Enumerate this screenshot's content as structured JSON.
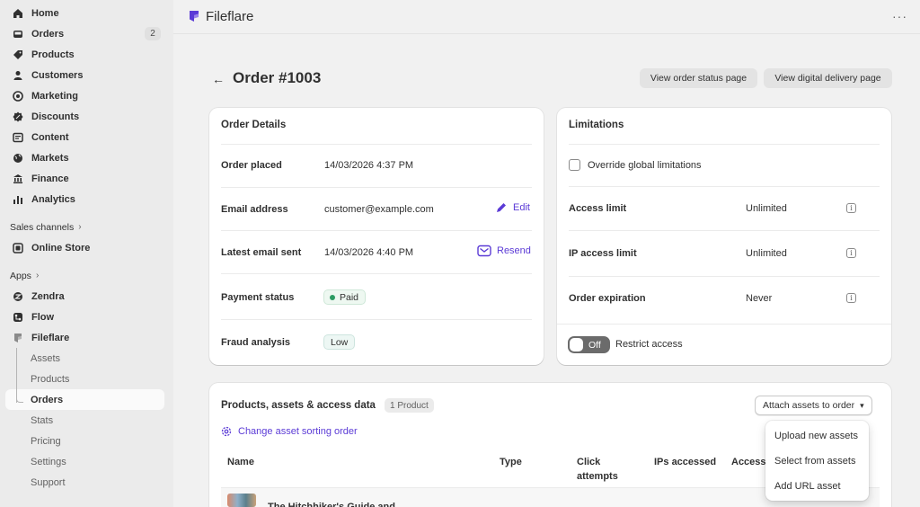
{
  "sidebar": {
    "items": [
      {
        "label": "Home",
        "icon": "home-icon"
      },
      {
        "label": "Orders",
        "icon": "inbox-icon",
        "badge": "2"
      },
      {
        "label": "Products",
        "icon": "tag-icon"
      },
      {
        "label": "Customers",
        "icon": "person-icon"
      },
      {
        "label": "Marketing",
        "icon": "target-icon"
      },
      {
        "label": "Discounts",
        "icon": "discount-icon"
      },
      {
        "label": "Content",
        "icon": "content-icon"
      },
      {
        "label": "Markets",
        "icon": "globe-icon"
      },
      {
        "label": "Finance",
        "icon": "bank-icon"
      },
      {
        "label": "Analytics",
        "icon": "bar-chart-icon"
      }
    ],
    "sales_channels_label": "Sales channels",
    "online_store": "Online Store",
    "apps_label": "Apps",
    "apps": [
      {
        "label": "Zendra"
      },
      {
        "label": "Flow"
      },
      {
        "label": "Fileflare"
      }
    ],
    "sub_items": [
      "Assets",
      "Products",
      "Orders",
      "Stats",
      "Pricing",
      "Settings",
      "Support"
    ]
  },
  "topbar": {
    "app_title": "Fileflare",
    "more": "···"
  },
  "header": {
    "back": "←",
    "title": "Order #1003",
    "btn_status": "View order status page",
    "btn_delivery": "View digital delivery page"
  },
  "order_details": {
    "title": "Order Details",
    "order_placed_label": "Order placed",
    "order_placed_value": "14/03/2026 4:37 PM",
    "email_label": "Email address",
    "email_value": "customer@example.com",
    "edit": "Edit",
    "latest_email_label": "Latest email sent",
    "latest_email_value": "14/03/2026 4:40 PM",
    "resend": "Resend",
    "payment_label": "Payment status",
    "payment_value": "Paid",
    "fraud_label": "Fraud analysis",
    "fraud_value": "Low"
  },
  "limitations": {
    "title": "Limitations",
    "override": "Override global limitations",
    "access_limit_label": "Access limit",
    "access_limit_value": "Unlimited",
    "ip_limit_label": "IP access limit",
    "ip_limit_value": "Unlimited",
    "expiration_label": "Order expiration",
    "expiration_value": "Never",
    "toggle_state": "Off",
    "restrict": "Restrict access"
  },
  "assets": {
    "title": "Products, assets & access data",
    "count": "1 Product",
    "attach": "Attach assets to order",
    "change_sort": "Change asset sorting order",
    "columns": [
      "Name",
      "Type",
      "Click attempts",
      "IPs accessed",
      "Access"
    ],
    "row_title": "The Hitchhiker's Guide and"
  },
  "dropdown": [
    "Upload new assets",
    "Select from assets",
    "Add URL asset"
  ]
}
